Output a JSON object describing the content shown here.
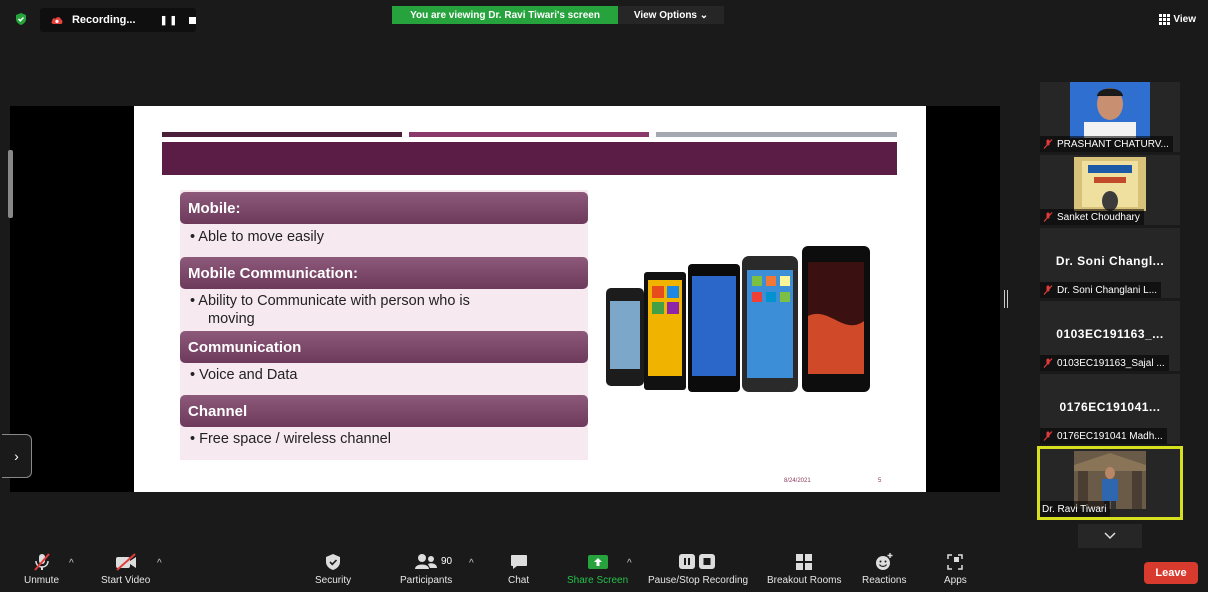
{
  "top_bar": {
    "recording_label": "Recording...",
    "viewing_banner": "You are viewing Dr. Ravi Tiwari's screen",
    "view_options_label": "View Options ⌄",
    "view_label": "View"
  },
  "slide": {
    "sections": [
      {
        "header": "Mobile:",
        "bullets": [
          "• Able to move  easily"
        ]
      },
      {
        "header": "Mobile Communication:",
        "bullets": [
          "• Ability to Communicate with person who is",
          "moving"
        ]
      },
      {
        "header": "Communication",
        "bullets": [
          "• Voice and Data"
        ]
      },
      {
        "header": "Channel",
        "bullets": [
          "• Free space / wireless channel"
        ]
      }
    ],
    "date": "8/24/2021",
    "page_number": "5"
  },
  "gallery": [
    {
      "name": "PRASHANT CHATURV...",
      "muted": true,
      "kind": "video"
    },
    {
      "name": "Sanket Choudhary",
      "muted": true,
      "kind": "video"
    },
    {
      "big_name": "Dr. Soni Changl...",
      "name": "Dr. Soni Changlani L...",
      "muted": true,
      "kind": "text"
    },
    {
      "big_name": "0103EC191163_...",
      "name": "0103EC191163_Sajal ...",
      "muted": true,
      "kind": "text"
    },
    {
      "big_name": "0176EC191041...",
      "name": "0176EC191041 Madh...",
      "muted": true,
      "kind": "text"
    },
    {
      "name": "Dr. Ravi Tiwari",
      "muted": false,
      "kind": "video",
      "active": true
    }
  ],
  "toolbar": {
    "unmute": "Unmute",
    "start_video": "Start Video",
    "security": "Security",
    "participants": "Participants",
    "participants_count": "90",
    "chat": "Chat",
    "share_screen": "Share Screen",
    "pause_stop_recording": "Pause/Stop Recording",
    "breakout_rooms": "Breakout Rooms",
    "reactions": "Reactions",
    "apps": "Apps",
    "leave": "Leave"
  },
  "colors": {
    "share_green": "#26a33d",
    "leave_red": "#d83a2e",
    "active_speaker": "#d6e01e",
    "slide_accent": "#5b1c45"
  }
}
